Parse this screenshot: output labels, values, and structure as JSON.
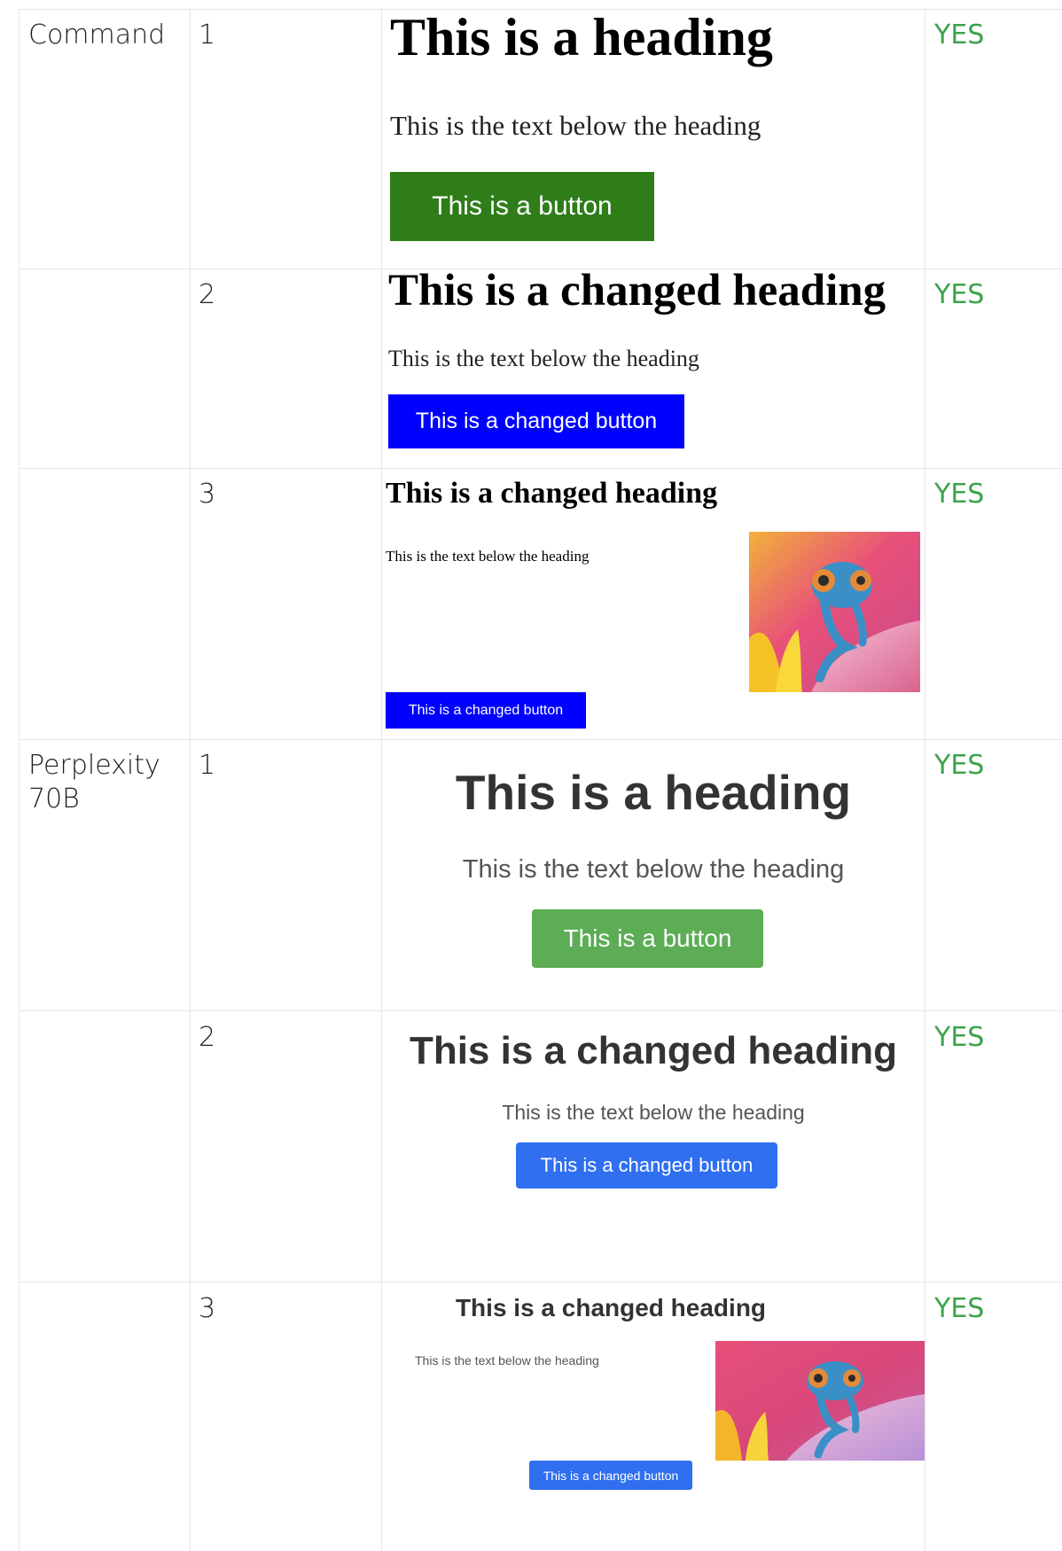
{
  "rows": [
    {
      "model": "Command",
      "run": "1",
      "result": "YES",
      "screenshot": {
        "heading": "This is a heading",
        "text": "This is the text below the heading",
        "button": "This is a button",
        "button_color": "#2e7d19"
      }
    },
    {
      "model": "",
      "run": "2",
      "result": "YES",
      "screenshot": {
        "heading": "This is a changed heading",
        "text": "This is the text below the heading",
        "button": "This is a changed button",
        "button_color": "#0000ff"
      }
    },
    {
      "model": "",
      "run": "3",
      "result": "YES",
      "screenshot": {
        "heading": "This is a changed heading",
        "text": "This is the text below the heading",
        "button": "This is a changed button",
        "button_color": "#0000ff",
        "image": "chameleon-image"
      }
    },
    {
      "model": "Perplexity 70B",
      "run": "1",
      "result": "YES",
      "screenshot": {
        "heading": "This is a heading",
        "text": "This is the text below the heading",
        "button": "This is a button",
        "button_color": "#5cad55"
      }
    },
    {
      "model": "",
      "run": "2",
      "result": "YES",
      "screenshot": {
        "heading": "This is a changed heading",
        "text": "This is the text below the heading",
        "button": "This is a changed button",
        "button_color": "#2f6ff0"
      }
    },
    {
      "model": "",
      "run": "3",
      "result": "YES",
      "screenshot": {
        "heading": "This is a changed heading",
        "text": "This is the text below the heading",
        "button": "This is a changed button",
        "button_color": "#2f6ff0",
        "image": "chameleon-image"
      }
    }
  ],
  "colors": {
    "result_text": "#3aa34a",
    "grid": "#e6e6e6"
  }
}
